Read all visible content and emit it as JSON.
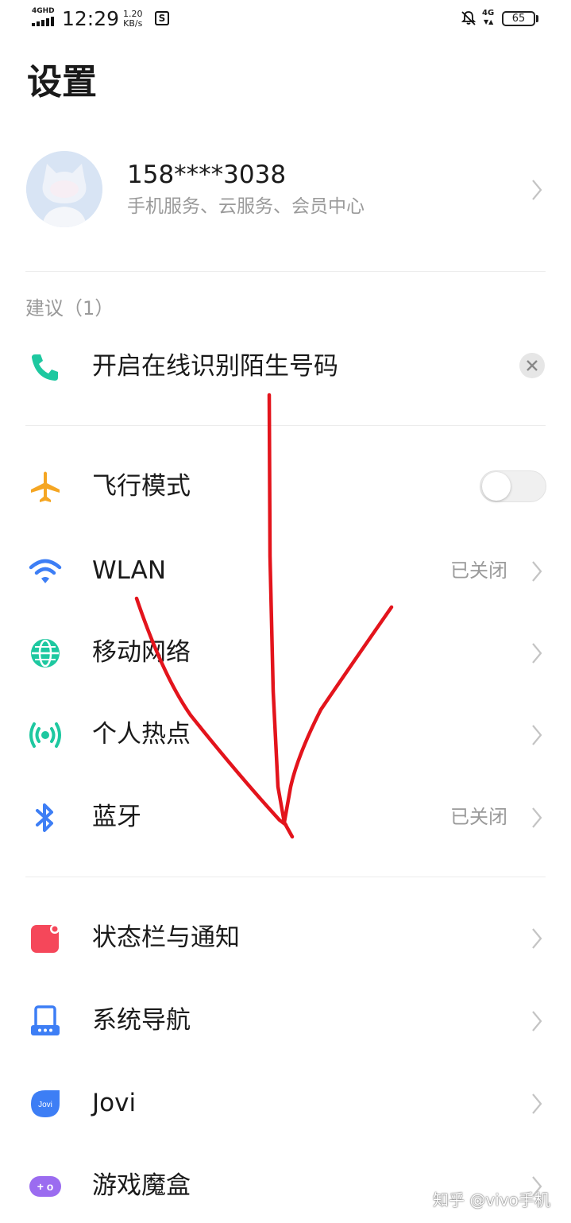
{
  "status_bar": {
    "network": "4GHD",
    "time": "12:29",
    "speed_value": "1.20",
    "speed_unit": "KB/s",
    "app_glyph": "S",
    "mobile_data": "4G",
    "battery": "65"
  },
  "page": {
    "title": "设置"
  },
  "account": {
    "phone": "158****3038",
    "subtitle": "手机服务、云服务、会员中心"
  },
  "suggestions": {
    "header": "建议（1）",
    "item": "开启在线识别陌生号码"
  },
  "connectivity": [
    {
      "label": "飞行模式",
      "icon": "airplane-icon",
      "toggle_on": false
    },
    {
      "label": "WLAN",
      "value": "已关闭",
      "icon": "wifi-icon"
    },
    {
      "label": "移动网络",
      "icon": "globe-icon"
    },
    {
      "label": "个人热点",
      "icon": "hotspot-icon"
    },
    {
      "label": "蓝牙",
      "value": "已关闭",
      "icon": "bluetooth-icon"
    }
  ],
  "system": [
    {
      "label": "状态栏与通知",
      "icon": "notification-icon"
    },
    {
      "label": "系统导航",
      "icon": "navigation-icon"
    },
    {
      "label": "Jovi",
      "icon": "jovi-icon",
      "icon_text": "Jovi"
    },
    {
      "label": "游戏魔盒",
      "icon": "game-box-icon",
      "icon_text": "+ o"
    }
  ],
  "watermark": "知乎 @vivo手机",
  "colors": {
    "green": "#1ec8a0",
    "orange": "#f5a623",
    "blue": "#3d7ef5",
    "red": "#f5475a",
    "purple": "#9b6cf0",
    "annotation_red": "#e3141c"
  }
}
